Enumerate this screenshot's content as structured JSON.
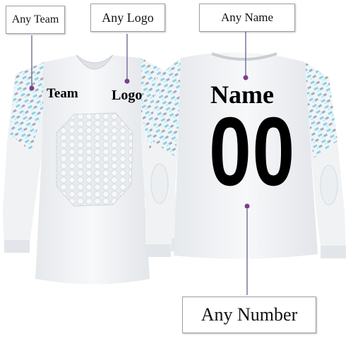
{
  "callouts": {
    "team": "Any Team",
    "logo": "Any Logo",
    "name": "Any Name",
    "number": "Any Number"
  },
  "jersey": {
    "front_team": "Team",
    "front_logo": "Logo",
    "back_name": "Name",
    "back_number": "00"
  },
  "colors": {
    "jersey_body": "#f4f6f8",
    "sleeve_pattern_blue": "#8fd0e8",
    "sleeve_pattern_gray": "#a9adb3",
    "pointer_line": "#6a5d8a",
    "pointer_dot": "#7a3f8a",
    "print_text": "#000000"
  }
}
